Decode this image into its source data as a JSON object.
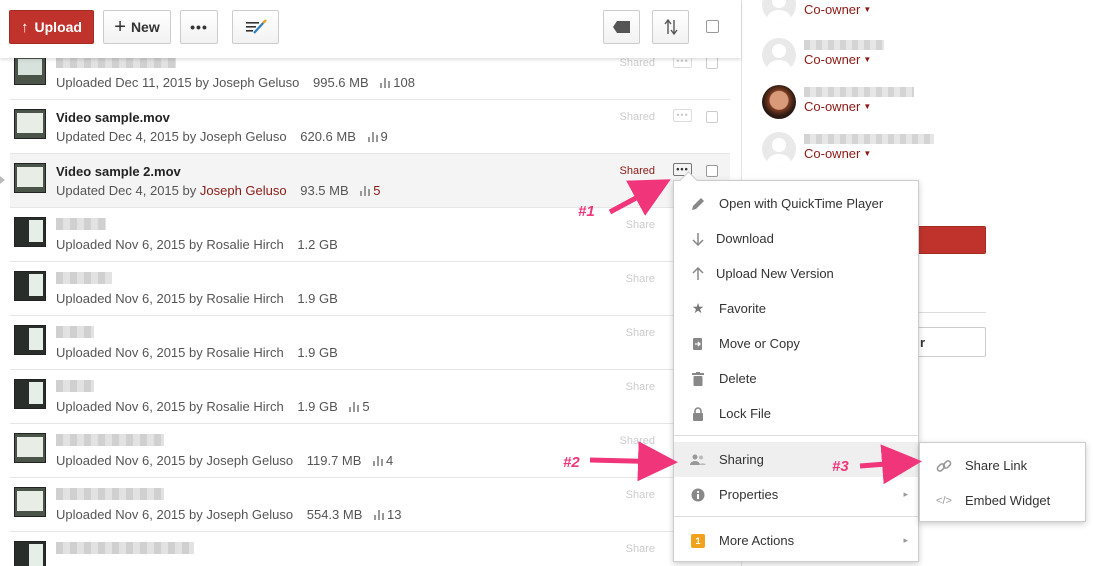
{
  "toolbar": {
    "upload_label": "Upload",
    "new_label": "New",
    "more_label": "•••"
  },
  "files": [
    {
      "name": "",
      "status": "Uploaded",
      "date": "Dec 11, 2015",
      "by": "by",
      "user": "Joseph Geluso",
      "size": "995.6 MB",
      "views": "108",
      "shared": "Shared"
    },
    {
      "name": "Video sample.mov",
      "status": "Updated",
      "date": "Dec 4, 2015",
      "by": "by",
      "user": "Joseph Geluso",
      "size": "620.6 MB",
      "views": "9",
      "shared": "Shared"
    },
    {
      "name": "Video sample 2.mov",
      "status": "Updated",
      "date": "Dec 4, 2015",
      "by": "by",
      "user": "Joseph Geluso",
      "size": "93.5 MB",
      "views": "5",
      "shared": "Shared"
    },
    {
      "name": "",
      "status": "Uploaded",
      "date": "Nov 6, 2015",
      "by": "by",
      "user": "Rosalie Hirch",
      "size": "1.2 GB",
      "views": "",
      "shared": "Share"
    },
    {
      "name": "",
      "status": "Uploaded",
      "date": "Nov 6, 2015",
      "by": "by",
      "user": "Rosalie Hirch",
      "size": "1.9 GB",
      "views": "",
      "shared": "Share"
    },
    {
      "name": "",
      "status": "Uploaded",
      "date": "Nov 6, 2015",
      "by": "by",
      "user": "Rosalie Hirch",
      "size": "1.9 GB",
      "views": "",
      "shared": "Share"
    },
    {
      "name": "",
      "status": "Uploaded",
      "date": "Nov 6, 2015",
      "by": "by",
      "user": "Rosalie Hirch",
      "size": "1.9 GB",
      "views": "5",
      "shared": "Share"
    },
    {
      "name": "",
      "status": "Uploaded",
      "date": "Nov 6, 2015",
      "by": "by",
      "user": "Joseph Geluso",
      "size": "119.7 MB",
      "views": "4",
      "shared": "Shared"
    },
    {
      "name": "",
      "status": "Uploaded",
      "date": "Nov 6, 2015",
      "by": "by",
      "user": "Joseph Geluso",
      "size": "554.3 MB",
      "views": "13",
      "shared": "Share"
    },
    {
      "name": "",
      "status": "",
      "date": "",
      "by": "",
      "user": "",
      "size": "",
      "views": "",
      "shared": "Share"
    }
  ],
  "collaborators": [
    {
      "role": "Co-owner"
    },
    {
      "role": "Co-owner"
    },
    {
      "role": "Co-owner"
    },
    {
      "role": "Co-owner"
    }
  ],
  "side": {
    "button_fragment": "r"
  },
  "context_menu": {
    "items": [
      {
        "label": "Open with QuickTime Player",
        "icon": "pencil-icon"
      },
      {
        "label": "Download",
        "icon": "arrow-down-icon"
      },
      {
        "label": "Upload New Version",
        "icon": "arrow-up-icon"
      },
      {
        "label": "Favorite",
        "icon": "star-icon"
      },
      {
        "label": "Move or Copy",
        "icon": "move-copy-icon"
      },
      {
        "label": "Delete",
        "icon": "trash-icon"
      },
      {
        "label": "Lock File",
        "icon": "lock-icon"
      },
      {
        "label": "Sharing",
        "icon": "people-icon"
      },
      {
        "label": "Properties",
        "icon": "info-icon"
      },
      {
        "label": "More Actions",
        "icon": "badge-icon",
        "badge": "1"
      }
    ]
  },
  "sharing_submenu": {
    "items": [
      {
        "label": "Share Link",
        "icon": "link-icon"
      },
      {
        "label": "Embed Widget",
        "icon": "code-icon"
      }
    ]
  },
  "annotations": {
    "a1": "#1",
    "a2": "#2",
    "a3": "#3"
  },
  "colors": {
    "brand_red": "#c0332c",
    "link_red": "#8b1a16",
    "annotation_pink": "#f0357a",
    "badge_orange": "#f0a21c"
  }
}
